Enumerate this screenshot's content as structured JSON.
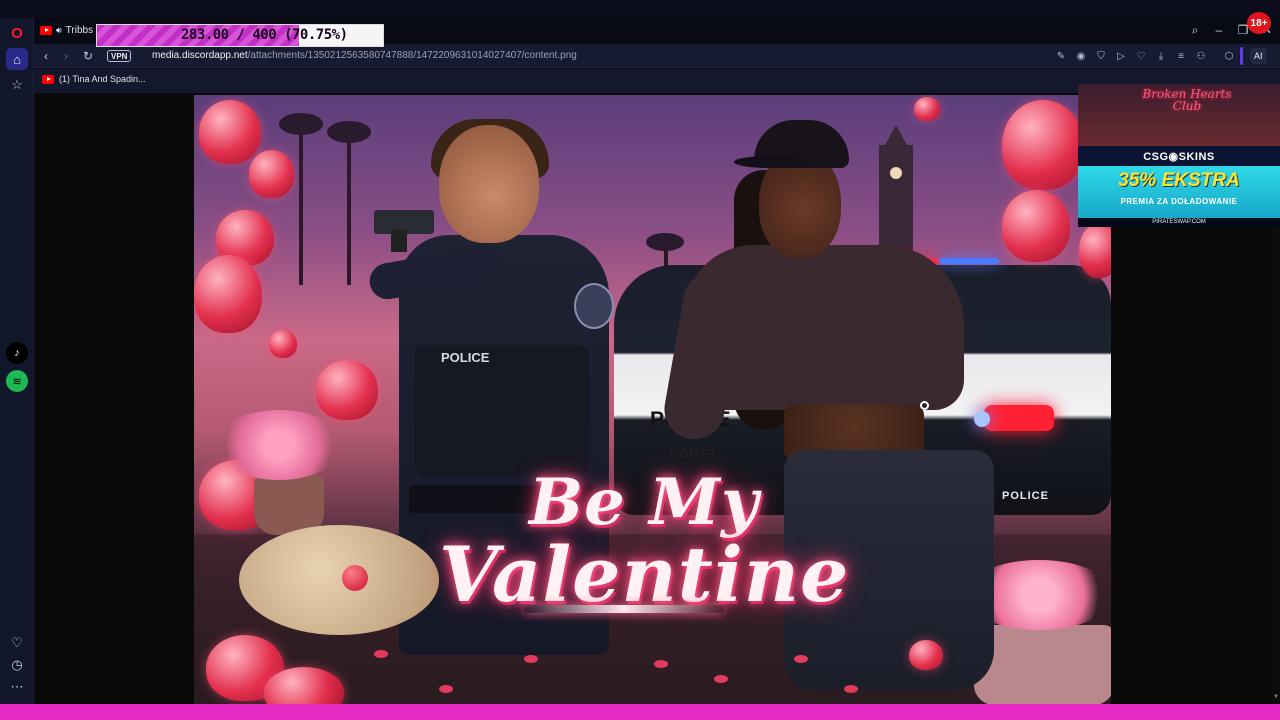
{
  "browser": {
    "tab": {
      "title": "Tribbs - D"
    },
    "address": {
      "vpn_label": "VPN",
      "url_host": "media.discordapp.net",
      "url_path": "/attachments/1350212563580747888/1472209631014027407/content.png"
    },
    "bookmarks": [
      {
        "label": "(1) Tina And Spadin..."
      }
    ],
    "ai_label": "AI",
    "age_badge": "18+"
  },
  "overlay": {
    "progress_text": "283.00 / 400 (70.75%)",
    "progress_fraction": 0.7075
  },
  "image": {
    "headline_line1": "Be My",
    "headline_line2": "Valentine",
    "car_door_text": "POLICE",
    "car_door_sub": "COMET",
    "car_rear_text": "POLICE",
    "officer_text": "POLICE"
  },
  "ad": {
    "club_title": "Broken Hearts Club",
    "brand": "CSG◉SKINS",
    "offer": "35% EKSTRA",
    "offer_sub": "PREMIA ZA DOŁADOWANIE",
    "footer": "PIRATESWAP.COM"
  },
  "colors": {
    "accent": "#5a3ee6",
    "bottom_bar": "#e82bc4",
    "progress_fill": "#c22fc7",
    "sidebar_bg": "#12162a"
  }
}
